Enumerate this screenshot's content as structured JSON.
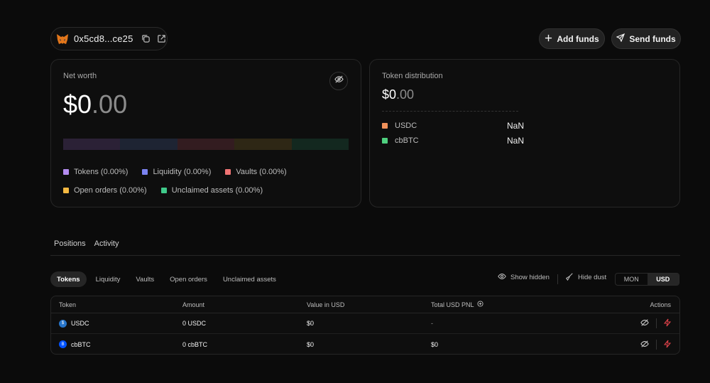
{
  "wallet": {
    "address": "0x5cd8...ce25"
  },
  "header": {
    "add_funds": "Add funds",
    "send_funds": "Send funds"
  },
  "net_worth": {
    "label": "Net worth",
    "value_int": "$0",
    "value_dec": ".00",
    "bar_colors": [
      "#2b2136",
      "#1e2433",
      "#331c20",
      "#2e2715",
      "#13281f"
    ],
    "legend": [
      {
        "label": "Tokens (0.00%)",
        "color": "#b48cf0"
      },
      {
        "label": "Liquidity (0.00%)",
        "color": "#7b83f0"
      },
      {
        "label": "Vaults (0.00%)",
        "color": "#f07474"
      },
      {
        "label": "Open orders (0.00%)",
        "color": "#f5b942"
      },
      {
        "label": "Unclaimed assets (0.00%)",
        "color": "#3fc98a"
      }
    ]
  },
  "token_distribution": {
    "label": "Token distribution",
    "value_int": "$0",
    "value_dec": ".00",
    "items": [
      {
        "name": "USDC",
        "value": "NaN",
        "color": "#f0915a"
      },
      {
        "name": "cbBTC",
        "value": "NaN",
        "color": "#4fd07f"
      }
    ]
  },
  "tabs": [
    "Positions",
    "Activity"
  ],
  "subtabs": [
    "Tokens",
    "Liquidity",
    "Vaults",
    "Open orders",
    "Unclaimed assets"
  ],
  "tools": {
    "show_hidden": "Show hidden",
    "hide_dust": "Hide dust",
    "currency": [
      "MON",
      "USD"
    ]
  },
  "table": {
    "headers": [
      "Token",
      "Amount",
      "Value in USD",
      "Total USD PNL",
      "Actions"
    ],
    "rows": [
      {
        "token": "USDC",
        "amount": "0 USDC",
        "value": "$0",
        "pnl": "-"
      },
      {
        "token": "cbBTC",
        "amount": "0 cbBTC",
        "value": "$0",
        "pnl": "$0"
      }
    ]
  }
}
